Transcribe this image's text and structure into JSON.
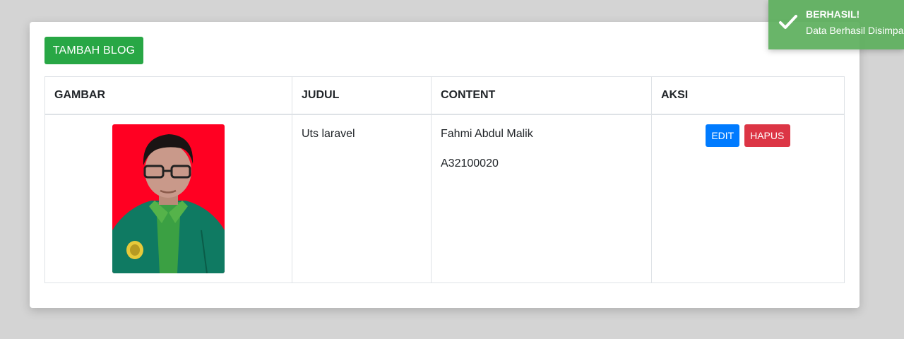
{
  "toolbar": {
    "add_label": "TAMBAH BLOG"
  },
  "table": {
    "headers": [
      "GAMBAR",
      "JUDUL",
      "CONTENT",
      "AKSI"
    ],
    "rows": [
      {
        "judul": "Uts laravel",
        "content": [
          "Fahmi Abdul Malik",
          "A32100020"
        ],
        "actions": {
          "edit": "EDIT",
          "hapus": "HAPUS"
        }
      }
    ]
  },
  "toast": {
    "title": "BERHASIL!",
    "message": "Data Berhasil Disimpan"
  },
  "colors": {
    "primary": "#007bff",
    "success": "#28a745",
    "danger": "#dc3545",
    "toast": "#5caf5c"
  }
}
